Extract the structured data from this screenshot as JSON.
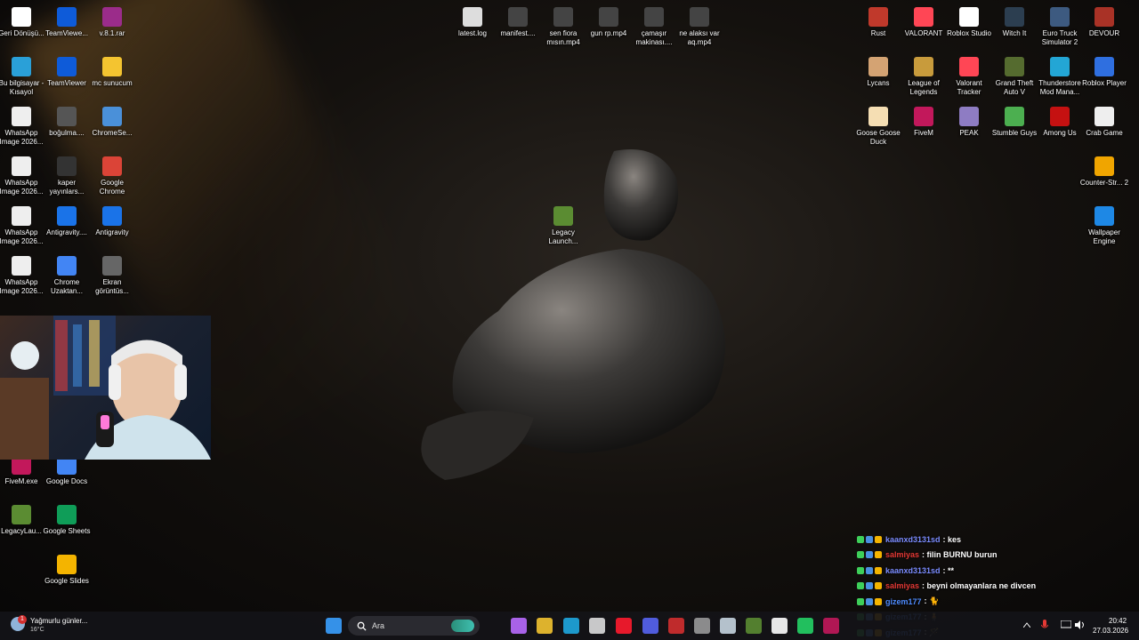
{
  "desktop": {
    "left_icons": [
      {
        "label": "Geri Dönüşü...",
        "icon": "recycle-bin-icon",
        "color": "#ffffff"
      },
      {
        "label": "TeamViewe...",
        "icon": "teamviewer-icon",
        "color": "#0e5bd9"
      },
      {
        "label": "v.8.1.rar",
        "icon": "archive-icon",
        "color": "#9b2c8a"
      },
      {
        "label": "Bu bilgisayar - Kısayol",
        "icon": "computer-icon",
        "color": "#2aa0d8"
      },
      {
        "label": "TeamViewer",
        "icon": "teamviewer-icon",
        "color": "#0e5bd9"
      },
      {
        "label": "mc sunucum",
        "icon": "folder-icon",
        "color": "#f4c430"
      },
      {
        "label": "WhatsApp Image 2026...",
        "icon": "image-file-icon",
        "color": "#eeeeee"
      },
      {
        "label": "boğulma....",
        "icon": "video-file-icon",
        "color": "#555555"
      },
      {
        "label": "ChromeSe...",
        "icon": "chrome-setup-icon",
        "color": "#4a90d9"
      },
      {
        "label": "WhatsApp Image 2026...",
        "icon": "image-file-icon",
        "color": "#eeeeee"
      },
      {
        "label": "kaper yayınlars...",
        "icon": "video-file-icon",
        "color": "#333333"
      },
      {
        "label": "Google Chrome",
        "icon": "chrome-icon",
        "color": "#db4437"
      },
      {
        "label": "WhatsApp Image 2026...",
        "icon": "image-file-icon",
        "color": "#eeeeee"
      },
      {
        "label": "Antigravity....",
        "icon": "antigravity-icon",
        "color": "#1a73e8"
      },
      {
        "label": "Antigravity",
        "icon": "antigravity-icon",
        "color": "#1a73e8"
      },
      {
        "label": "WhatsApp Image 2026...",
        "icon": "image-file-icon",
        "color": "#eeeeee"
      },
      {
        "label": "Chrome Uzaktan...",
        "icon": "chrome-remote-icon",
        "color": "#4285f4"
      },
      {
        "label": "Ekran görüntüs...",
        "icon": "screenshot-icon",
        "color": "#666666"
      },
      {
        "label": "FiveM.exe",
        "icon": "fivem-icon",
        "color": "#c2185b"
      },
      {
        "label": "Google Docs",
        "icon": "google-docs-icon",
        "color": "#4285f4"
      },
      {
        "label": "LegacyLau...",
        "icon": "minecraft-icon",
        "color": "#5b8c32"
      },
      {
        "label": "Google Sheets",
        "icon": "google-sheets-icon",
        "color": "#0f9d58"
      },
      {
        "label": "Google Slides",
        "icon": "google-slides-icon",
        "color": "#f4b400"
      }
    ],
    "top_icons": [
      {
        "label": "latest.log",
        "icon": "text-file-icon",
        "color": "#dddddd"
      },
      {
        "label": "manifest....",
        "icon": "video-file-icon",
        "color": "#444444"
      },
      {
        "label": "sen fiora mısın.mp4",
        "icon": "video-file-icon",
        "color": "#444444"
      },
      {
        "label": "gun rp.mp4",
        "icon": "video-file-icon",
        "color": "#444444"
      },
      {
        "label": "çamaşır makinası....",
        "icon": "video-file-icon",
        "color": "#444444"
      },
      {
        "label": "ne alaksı var aq.mp4",
        "icon": "video-file-icon",
        "color": "#444444"
      },
      {
        "label": "Legacy Launch...",
        "icon": "minecraft-icon",
        "color": "#5b8c32"
      }
    ],
    "right_icons": [
      {
        "label": "Rust",
        "icon": "rust-icon",
        "color": "#c0392b"
      },
      {
        "label": "VALORANT",
        "icon": "valorant-icon",
        "color": "#ff4655"
      },
      {
        "label": "Roblox Studio",
        "icon": "roblox-studio-icon",
        "color": "#ffffff"
      },
      {
        "label": "Witch It",
        "icon": "witch-it-icon",
        "color": "#2c3e50"
      },
      {
        "label": "Euro Truck Simulator 2",
        "icon": "truck-icon",
        "color": "#3d5a80"
      },
      {
        "label": "DEVOUR",
        "icon": "devour-icon",
        "color": "#a93226"
      },
      {
        "label": "Lycans",
        "icon": "lycans-icon",
        "color": "#d4a373"
      },
      {
        "label": "League of Legends",
        "icon": "league-icon",
        "color": "#c89b3c"
      },
      {
        "label": "Valorant Tracker",
        "icon": "tracker-icon",
        "color": "#ff4655"
      },
      {
        "label": "Grand Theft Auto V",
        "icon": "gta-icon",
        "color": "#556b2f"
      },
      {
        "label": "Thunderstore Mod Mana...",
        "icon": "thunderstore-icon",
        "color": "#23a6d5"
      },
      {
        "label": "Roblox Player",
        "icon": "roblox-icon",
        "color": "#2f6fe0"
      },
      {
        "label": "Goose Goose Duck",
        "icon": "goose-icon",
        "color": "#f5deb3"
      },
      {
        "label": "FiveM",
        "icon": "fivem-icon",
        "color": "#c2185b"
      },
      {
        "label": "PEAK",
        "icon": "peak-icon",
        "color": "#8e7cc3"
      },
      {
        "label": "Stumble Guys",
        "icon": "stumble-icon",
        "color": "#4caf50"
      },
      {
        "label": "Among Us",
        "icon": "among-us-icon",
        "color": "#c51111"
      },
      {
        "label": "Crab Game",
        "icon": "crab-game-icon",
        "color": "#eeeeee"
      },
      {
        "label": "Counter-Str... 2",
        "icon": "cs2-icon",
        "color": "#f0a500"
      },
      {
        "label": "Wallpaper Engine",
        "icon": "wallpaper-engine-icon",
        "color": "#1e88e5"
      }
    ]
  },
  "chat": [
    {
      "user": "kaanxd3131sd",
      "message": ": kes",
      "user_color": "#7b8cff"
    },
    {
      "user": "salmiyas",
      "message": ": filin BURNU burun",
      "user_color": "#e53935"
    },
    {
      "user": "kaanxd3131sd",
      "message": ": **",
      "user_color": "#7b8cff"
    },
    {
      "user": "salmiyas",
      "message": ": beyni olmayanlara ne divcen",
      "user_color": "#e53935"
    },
    {
      "user": "gizem177",
      "message": ": 🐈",
      "user_color": "#4f8cff"
    },
    {
      "user": "gizem177",
      "message": ": 🧍",
      "user_color": "#4f8cff"
    },
    {
      "user": "gizem177",
      "message": ": 🪄",
      "user_color": "#4f8cff"
    }
  ],
  "taskbar": {
    "weather_text": "Yağmurlu günler...",
    "weather_temp": "16°C",
    "weather_badge": "1",
    "search_placeholder": "Ara",
    "apps": [
      {
        "icon": "windows-start-icon",
        "color": "#3aa0ff"
      },
      {
        "icon": "task-view-icon",
        "color": "#cccccc"
      },
      {
        "icon": "copilot-icon",
        "color": "#b96bff"
      },
      {
        "icon": "file-explorer-icon",
        "color": "#f4c430"
      },
      {
        "icon": "edge-icon",
        "color": "#1fa8e0"
      },
      {
        "icon": "microsoft-store-icon",
        "color": "#dddddd"
      },
      {
        "icon": "opera-icon",
        "color": "#ff1b2d"
      },
      {
        "icon": "discord-icon",
        "color": "#5865f2"
      },
      {
        "icon": "obs-recording-icon",
        "color": "#d32f2f"
      },
      {
        "icon": "calculator-icon",
        "color": "#999999"
      },
      {
        "icon": "steam-icon",
        "color": "#c7d5e0"
      },
      {
        "icon": "minecraft-icon",
        "color": "#5b8c32"
      },
      {
        "icon": "capcut-icon",
        "color": "#ffffff"
      },
      {
        "icon": "whatsapp-icon",
        "color": "#25d366"
      },
      {
        "icon": "fivem-icon",
        "color": "#c2185b"
      }
    ],
    "time": "20:42",
    "date": "27.03.2026"
  }
}
